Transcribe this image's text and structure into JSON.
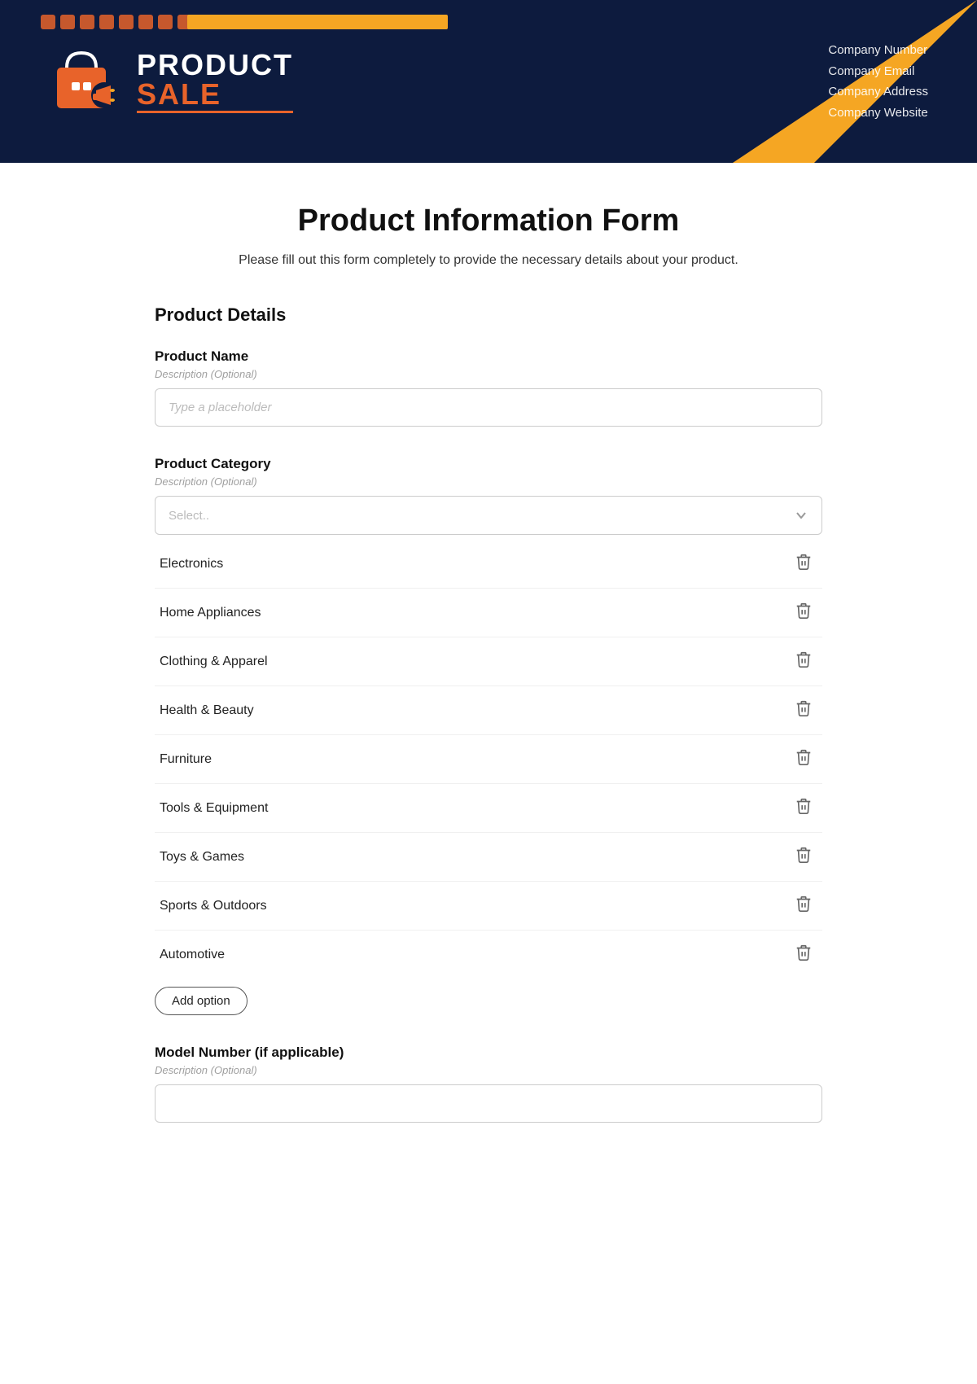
{
  "header": {
    "logo_product": "PRODUCT",
    "logo_sale": "SALE",
    "company_number": "Company Number",
    "company_email": "Company Email",
    "company_address": "Company Address",
    "company_website": "Company Website"
  },
  "page": {
    "title": "Product Information Form",
    "subtitle": "Please fill out this form completely to provide the necessary details about your product."
  },
  "sections": {
    "product_details": {
      "label": "Product Details",
      "fields": {
        "product_name": {
          "label": "Product Name",
          "description": "Description (Optional)",
          "placeholder": "Type a placeholder"
        },
        "product_category": {
          "label": "Product Category",
          "description": "Description (Optional)",
          "select_placeholder": "Select..",
          "options": [
            "Electronics",
            "Home Appliances",
            "Clothing & Apparel",
            "Health & Beauty",
            "Furniture",
            "Tools & Equipment",
            "Toys & Games",
            "Sports & Outdoors",
            "Automotive"
          ],
          "add_option_label": "Add option"
        },
        "model_number": {
          "label": "Model Number (if applicable)",
          "description": "Description (Optional)"
        }
      }
    }
  }
}
